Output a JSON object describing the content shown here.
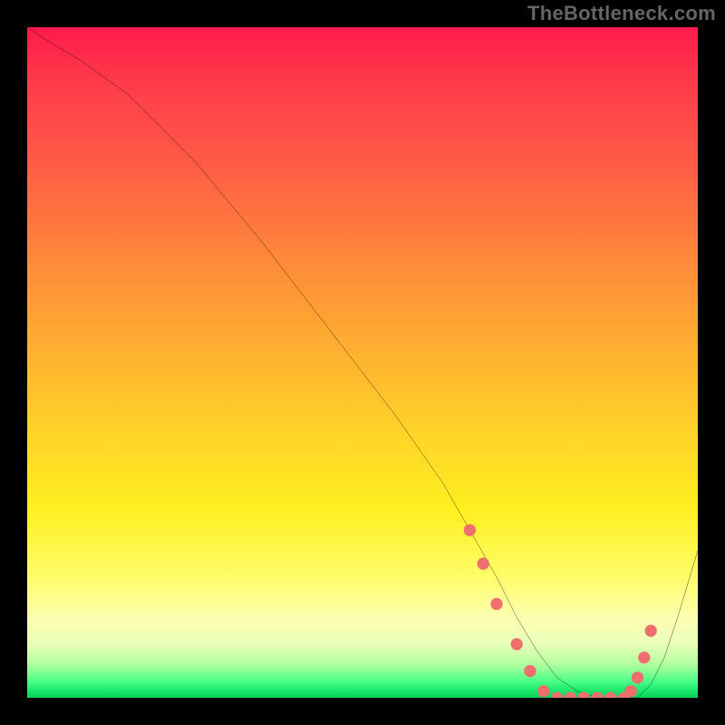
{
  "watermark": "TheBottleneck.com",
  "colors": {
    "background": "#000000",
    "curve": "#000000",
    "marker": "#ef6e6e",
    "gradient_top": "#ff1a4b",
    "gradient_bottom": "#0bcf5e"
  },
  "chart_data": {
    "type": "line",
    "title": "",
    "xlabel": "",
    "ylabel": "",
    "xlim": [
      0,
      100
    ],
    "ylim": [
      0,
      100
    ],
    "x": [
      0,
      3,
      8,
      15,
      25,
      35,
      45,
      55,
      62,
      66,
      70,
      73,
      76,
      79,
      82,
      85,
      87,
      89,
      91,
      93,
      95,
      97,
      100
    ],
    "y": [
      100,
      98,
      95,
      90,
      80,
      68,
      55,
      42,
      32,
      25,
      18,
      12,
      7,
      3,
      1,
      0,
      0,
      0,
      0,
      2,
      6,
      12,
      22
    ],
    "markers_x": [
      66,
      68,
      70,
      73,
      75,
      77,
      79,
      81,
      83,
      85,
      87,
      89,
      90,
      91,
      92,
      93
    ],
    "markers_y": [
      25,
      20,
      14,
      8,
      4,
      1,
      0,
      0,
      0,
      0,
      0,
      0,
      1,
      3,
      6,
      10
    ]
  }
}
